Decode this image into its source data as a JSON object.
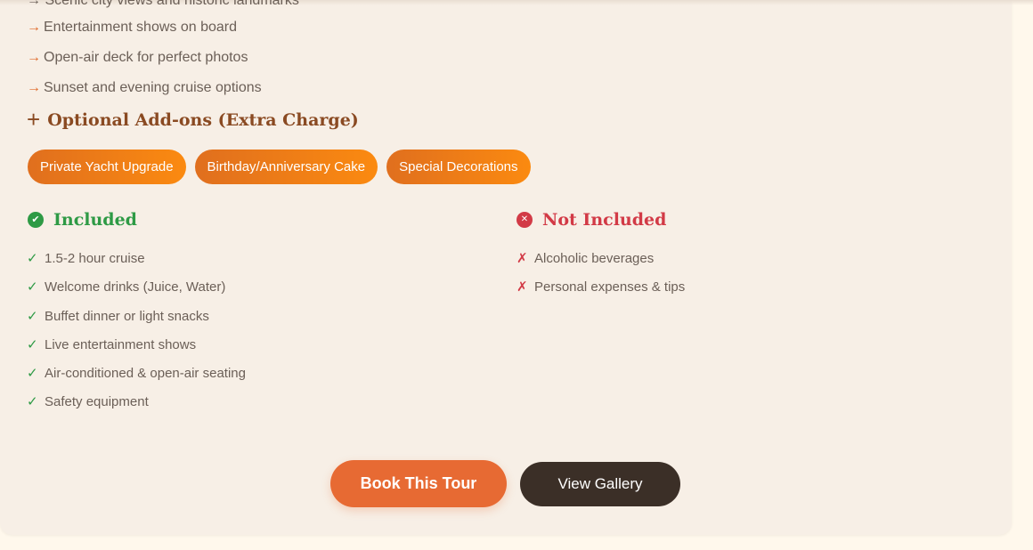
{
  "features": {
    "cutoff_text": "→ Scenic city views and historic landmarks",
    "items": [
      "Entertainment shows on board",
      "Open-air deck for perfect photos",
      "Sunset and evening cruise options"
    ],
    "arrow_glyph": "→"
  },
  "addons": {
    "icon": "plus-icon",
    "heading": "Optional Add-ons (Extra Charge)",
    "items": [
      "Private Yacht Upgrade",
      "Birthday/Anniversary Cake",
      "Special Decorations"
    ]
  },
  "included": {
    "icon": "check-circle-icon",
    "heading": "Included",
    "mark_glyph": "✓",
    "items": [
      "1.5-2 hour cruise",
      "Welcome drinks (Juice, Water)",
      "Buffet dinner or light snacks",
      "Live entertainment shows",
      "Air-conditioned & open-air seating",
      "Safety equipment"
    ]
  },
  "not_included": {
    "icon": "x-circle-icon",
    "heading": "Not Included",
    "mark_glyph": "✗",
    "items": [
      "Alcoholic beverages",
      "Personal expenses & tips"
    ]
  },
  "actions": {
    "book_label": "Book This Tour",
    "gallery_label": "View Gallery"
  },
  "colors": {
    "accent_orange": "#e76a33",
    "included_green": "#2e9a45",
    "excluded_red": "#d23a46",
    "dark_button": "#3b2f27",
    "card_bg": "#f7efe6"
  }
}
